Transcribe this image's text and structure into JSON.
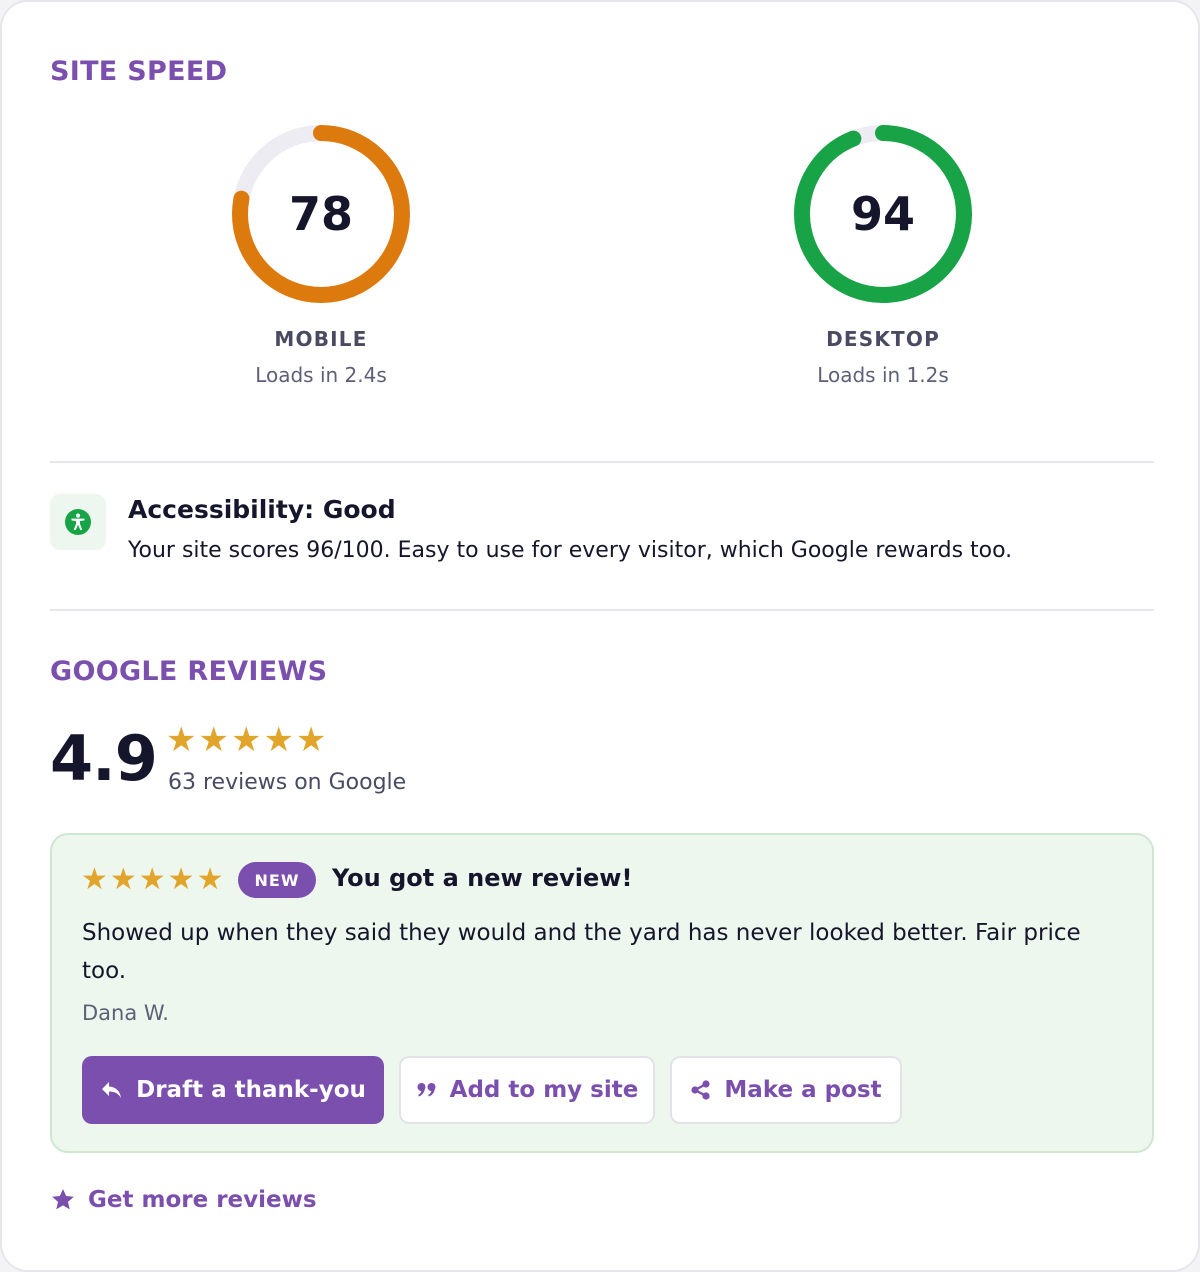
{
  "site_speed": {
    "title": "SITE SPEED",
    "mobile": {
      "score": "78",
      "score_value": 78,
      "label": "MOBILE",
      "load_text": "Loads in 2.4s",
      "color": "#dd7a0e"
    },
    "desktop": {
      "score": "94",
      "score_value": 94,
      "label": "DESKTOP",
      "load_text": "Loads in 1.2s",
      "color": "#18a347"
    },
    "track_color": "#ececf2"
  },
  "accessibility": {
    "icon": "accessibility-icon",
    "icon_color": "#18a347",
    "title": "Accessibility: Good",
    "description": "Your site scores 96/100. Easy to use for every visitor, which Google rewards too."
  },
  "google_reviews": {
    "title": "GOOGLE REVIEWS",
    "rating": "4.9",
    "stars": "★★★★★",
    "star_count": 5,
    "count_text": "63 reviews on Google",
    "star_color": "#e0a52a",
    "latest_review": {
      "stars": "★★★★★",
      "badge": "NEW",
      "heading": "You got a new review!",
      "text": "Showed up when they said they would and the yard has never looked better. Fair price too.",
      "author": "Dana W."
    },
    "actions": {
      "draft_label": "Draft a thank-you",
      "draft_icon": "reply-icon",
      "add_label": "Add to my site",
      "add_icon": "quote-icon",
      "post_label": "Make a post",
      "post_icon": "share-icon"
    },
    "more_link": {
      "label": "Get more reviews",
      "icon": "star-icon"
    }
  },
  "colors": {
    "accent": "#7b4fae",
    "text": "#15162b",
    "muted": "#5e6078"
  }
}
